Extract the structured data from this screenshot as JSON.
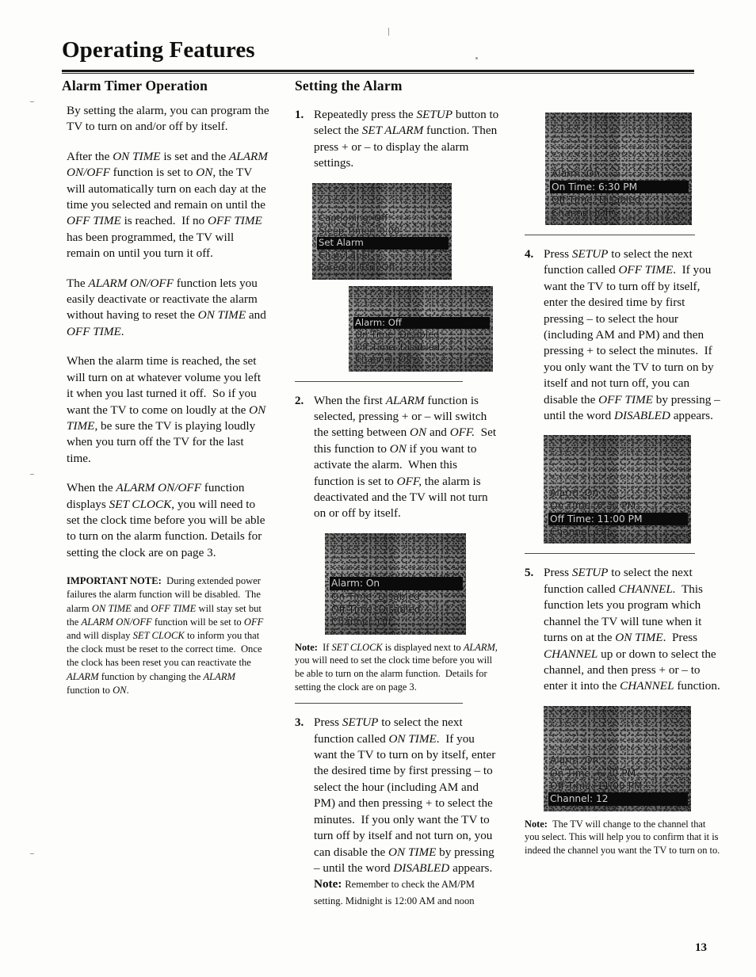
{
  "page": {
    "title": "Operating Features",
    "number": "13"
  },
  "left_column": {
    "heading": "Alarm Timer Operation",
    "paragraphs": [
      "By setting the alarm, you can program the TV to turn on and/or off by itself.",
      "After the ON TIME is set and the ALARM ON/OFF function is set to ON, the TV will automatically turn on each day at the time you selected and remain on until the OFF TIME is reached.  If no OFF TIME has been programmed, the TV will remain on until you turn it off.",
      "The ALARM ON/OFF function lets you easily deactivate or reactivate the alarm without having to reset the ON TIME and OFF TIME.",
      "When the alarm time is reached, the set will turn on at whatever volume you left it when you last turned it off.  So if you want the TV to come on loudly at the ON TIME, be sure the TV is playing loudly when you turn off the TV for the last time.",
      "When the ALARM ON/OFF function displays SET CLOCK, you will need to set the clock time before you will be able to turn on the alarm function.  Details for setting the clock are on page 3."
    ],
    "important_note": {
      "label": "IMPORTANT NOTE:",
      "text": "During extended power failures the alarm function will be disabled.  The alarm ON TIME and OFF TIME will stay set but the ALARM ON/OFF function will be set to OFF and will display SET CLOCK to inform you that the clock must be reset to the correct time.  Once the clock has been reset you can reactivate the ALARM function by changing the ALARM function to ON."
    }
  },
  "middle_column": {
    "heading": "Setting the Alarm",
    "steps": [
      {
        "number": "1.",
        "text": "Repeatedly press the SETUP button to select the SET ALARM function.  Then press + or – to display the alarm settings."
      },
      {
        "number": "2.",
        "text": "When the first ALARM function is selected, pressing + or – will switch the setting between ON and OFF.  Set this function to ON if you want to activate the alarm.  When this function is set to OFF, the alarm is deactivated and the TV will not turn on or off by itself."
      },
      {
        "number": "3.",
        "text": "Press SETUP to select the next function called ON TIME.  If you want the TV to turn on by itself, enter the desired time by first pressing – to select the hour (including AM and PM) and then pressing + to select the minutes.  If you only want the TV to turn off by itself and not turn on, you can disable the ON TIME by pressing – until the word DISABLED appears."
      }
    ],
    "note_set_clock": {
      "label": "Note:",
      "text": "If SET CLOCK is displayed next to ALARM, you will need to set the clock time before you will be able to turn on the alarm function.  Details for setting the clock are on page 3."
    },
    "note_ampm": {
      "label": "Note:",
      "text": "Remember to check the AM/PM setting.  Midnight is 12:00 AM and noon"
    }
  },
  "right_column": {
    "steps": [
      {
        "number": "4.",
        "text": "Press SETUP to select the next function called OFF TIME.  If you want the TV to turn off by itself, enter the desired time by first pressing – to select the hour (including AM and PM) and then pressing + to select the minutes.  If you only want the TV to turn on by itself and not turn off, you can disable the OFF TIME by pressing – until the word DISABLED appears."
      },
      {
        "number": "5.",
        "text": "Press SETUP to select the next function called CHANNEL.  This function lets you program which channel the TV will tune when it turns on at the ON TIME.  Press CHANNEL up or down to select the channel, and then press + or – to enter it into the CHANNEL function."
      }
    ],
    "note_channel": {
      "label": "Note:",
      "text": "The TV will change to the channel that you select.  This will help you to confirm that it is indeed the channel you want the TV to turn on to."
    }
  },
  "tv_screens": {
    "setup_menu": {
      "caption": "setup-menu-osd",
      "rows": [
        {
          "text": "Captioning:  Off",
          "highlighted": false
        },
        {
          "text": "Sleep Timer:  0:00",
          "highlighted": false
        },
        {
          "text": "Set Alarm",
          "highlighted": true
        },
        {
          "text": "Chan Label",
          "highlighted": false
        },
        {
          "text": "Parental Ctrl:  Off",
          "highlighted": false
        }
      ]
    },
    "alarm_off": {
      "caption": "alarm-off-osd",
      "rows": [
        {
          "text": "Alarm:  Off",
          "highlighted": true
        },
        {
          "text": "On Time:  Disabled",
          "highlighted": false
        },
        {
          "text": "Off Time:  Disabled",
          "highlighted": false
        },
        {
          "text": "Channel:  Off",
          "highlighted": false
        }
      ]
    },
    "alarm_on": {
      "caption": "alarm-on-osd",
      "rows": [
        {
          "text": "Alarm:  On",
          "highlighted": true
        },
        {
          "text": "On Time:  Disabled",
          "highlighted": false
        },
        {
          "text": "Off Time:  Disabled",
          "highlighted": false
        },
        {
          "text": "Channel:  Off",
          "highlighted": false
        }
      ]
    },
    "on_time": {
      "caption": "on-time-osd",
      "rows": [
        {
          "text": "Alarm:  On",
          "highlighted": false
        },
        {
          "text": "On Time:  6:30 PM",
          "highlighted": true
        },
        {
          "text": "Off Time:  Disabled",
          "highlighted": false
        },
        {
          "text": "Channel:  Off",
          "highlighted": false
        }
      ]
    },
    "off_time": {
      "caption": "off-time-osd",
      "rows": [
        {
          "text": "Alarm:  On",
          "highlighted": false
        },
        {
          "text": "On Time:  6:30 PM",
          "highlighted": false
        },
        {
          "text": "Off Time:  11:00 PM",
          "highlighted": true
        },
        {
          "text": "Channel:  Off",
          "highlighted": false
        }
      ]
    },
    "channel": {
      "caption": "channel-osd",
      "rows": [
        {
          "text": "Alarm:  On",
          "highlighted": false
        },
        {
          "text": "On Time:  6:30 PM",
          "highlighted": false
        },
        {
          "text": "Off Time:  11:00 PM",
          "highlighted": false
        },
        {
          "text": "Channel:  12",
          "highlighted": true
        }
      ]
    }
  }
}
